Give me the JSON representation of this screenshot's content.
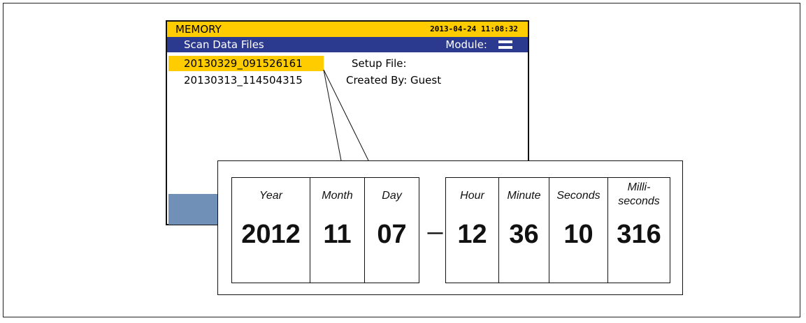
{
  "screen": {
    "title": "MEMORY",
    "datetime": "2013-04-24 11:08:32",
    "subtitle": "Scan Data Files",
    "module_label": "Module:",
    "module_icon": "equals-icon",
    "files": [
      {
        "name": "20130329_091526161",
        "selected": true
      },
      {
        "name": "20130313_114504315",
        "selected": false
      }
    ],
    "setup_file_label": "Setup File:",
    "created_by": "Created By: Guest"
  },
  "breakdown": {
    "fields": [
      {
        "label": "Year",
        "value": "2012"
      },
      {
        "label": "Month",
        "value": "11"
      },
      {
        "label": "Day",
        "value": "07"
      },
      {
        "label": "Hour",
        "value": "12"
      },
      {
        "label": "Minute",
        "value": "36"
      },
      {
        "label": "Seconds",
        "value": "10"
      },
      {
        "label": "Milli-\nseconds",
        "value": "316"
      }
    ],
    "separator": "_"
  },
  "colors": {
    "title_bar": "#ffcc00",
    "sub_bar": "#2b3a8f",
    "selection": "#ffcc00",
    "softkey": "#7090b8"
  }
}
